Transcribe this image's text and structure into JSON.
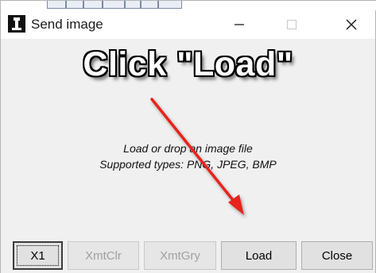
{
  "window": {
    "title": "Send image",
    "icon": "app-icon"
  },
  "controls": {
    "minimize_icon": "minimize-icon",
    "maximize_icon": "maximize-icon",
    "close_icon": "close-icon"
  },
  "overlay": {
    "instruction": "Click \"Load\"",
    "arrow_color": "#e8221b"
  },
  "content": {
    "hint_line1": "Load or drop an image file",
    "hint_line2": "Supported types: PNG, JPEG, BMP"
  },
  "buttons": [
    {
      "label": "X1",
      "enabled": true,
      "focused": true
    },
    {
      "label": "XmtClr",
      "enabled": false
    },
    {
      "label": "XmtGry",
      "enabled": false
    },
    {
      "label": "Load",
      "enabled": true
    },
    {
      "label": "Close",
      "enabled": true
    }
  ]
}
